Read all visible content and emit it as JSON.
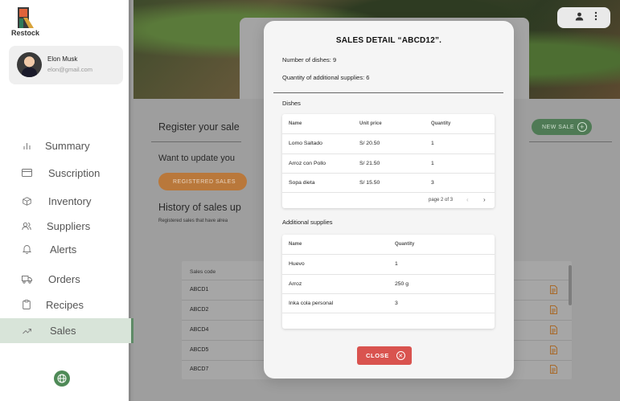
{
  "app": {
    "name": "Restock"
  },
  "user": {
    "name": "Elon Musk",
    "email": "elon@gmail.com"
  },
  "nav": [
    {
      "label": "Summary",
      "icon": "bar-chart-icon"
    },
    {
      "label": "Suscription",
      "icon": "credit-card-icon"
    },
    {
      "label": "Inventory",
      "icon": "box-icon"
    },
    {
      "label": "Suppliers",
      "icon": "users-icon"
    },
    {
      "label": "Alerts",
      "icon": "bell-icon"
    },
    {
      "label": "Orders",
      "icon": "truck-icon"
    },
    {
      "label": "Recipes",
      "icon": "clipboard-icon"
    },
    {
      "label": "Sales",
      "icon": "trending-icon",
      "active": true
    }
  ],
  "background": {
    "register_heading": "Register your sale",
    "update_text": "Want to update you",
    "registered_sales_button": "REGISTERED SALES",
    "new_sale_button": "NEW SALE",
    "history_heading": "History of sales up",
    "history_sub": "Registered sales that have alrea",
    "sales_table": {
      "header": "Sales code",
      "rows": [
        "ABCD1",
        "ABCD2",
        "ABCD4",
        "ABCD5",
        "ABCD7"
      ]
    }
  },
  "modal": {
    "title": "SALES DETAIL “ABCD12”.",
    "dishes_count_label": "Number of dishes: 9",
    "supplies_qty_label": "Quantity of additional supplies: 6",
    "dishes_section": "Dishes",
    "dishes_table": {
      "headers": [
        "Name",
        "Unit price",
        "Quantity"
      ],
      "rows": [
        [
          "Lomo Saltado",
          "S/ 20.50",
          "1"
        ],
        [
          "Arroz con Pollo",
          "S/ 21.50",
          "1"
        ],
        [
          "Sopa dieta",
          "S/ 15.50",
          "3"
        ]
      ],
      "pagination": "page 2 of 3"
    },
    "supplies_section": "Additional supplies",
    "supplies_table": {
      "headers": [
        "Name",
        "Quantity"
      ],
      "rows": [
        [
          "Huevo",
          "1"
        ],
        [
          "Arroz",
          "250 g"
        ],
        [
          "Inka cola personal",
          "3"
        ]
      ]
    },
    "close_button": "CLOSE"
  },
  "colors": {
    "accent_green": "#4f7a55",
    "accent_orange": "#b9783b",
    "close_red": "#d9534f",
    "active_nav": "#d8e4d9"
  }
}
